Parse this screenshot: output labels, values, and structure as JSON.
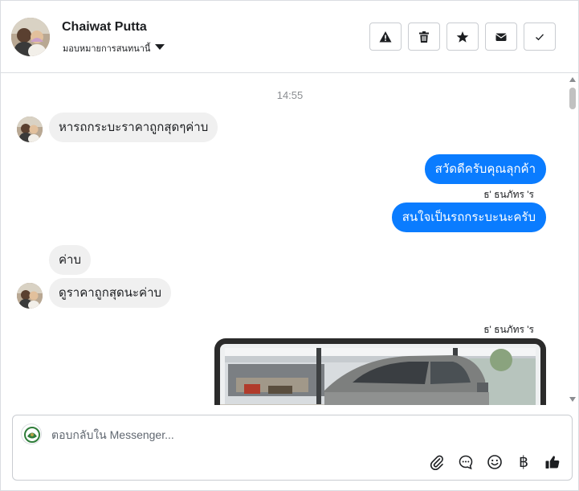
{
  "header": {
    "contact_name": "Chaiwat Putta",
    "assign_label": "มอบหมายการสนทนานี้",
    "actions": [
      {
        "name": "spam-button",
        "icon": "warning-icon"
      },
      {
        "name": "delete-button",
        "icon": "trash-icon"
      },
      {
        "name": "star-button",
        "icon": "star-icon"
      },
      {
        "name": "mark-unread-button",
        "icon": "envelope-icon"
      },
      {
        "name": "mark-done-button",
        "icon": "check-icon"
      }
    ]
  },
  "conversation": {
    "timestamp": "14:55",
    "messages": [
      {
        "direction": "in",
        "text": "หารถกระบะราคาถูกสุดๆค่าบ"
      },
      {
        "direction": "out",
        "text": "สวัดดีครับคุณลุกค้า"
      },
      {
        "direction": "out",
        "sender": "ธ' ธนภัทร 'ร",
        "text": "สนใจเป็นรถกระบะนะครับ"
      },
      {
        "direction": "in",
        "text": "ค่าบ"
      },
      {
        "direction": "in",
        "text": "ดูราคาถูกสุดนะค่าบ"
      },
      {
        "direction": "out",
        "sender": "ธ' ธนภัทร 'ร",
        "attachment": "photo"
      }
    ]
  },
  "composer": {
    "placeholder": "ตอบกลับใน Messenger...",
    "value": "",
    "tools": [
      "paperclip-icon",
      "chat-bubble-icon",
      "smiley-icon",
      "baht-icon",
      "thumbs-up-icon"
    ],
    "baht_symbol": "฿"
  },
  "colors": {
    "outgoing_bubble": "#0a7cff",
    "incoming_bubble": "#f0f0f0"
  }
}
